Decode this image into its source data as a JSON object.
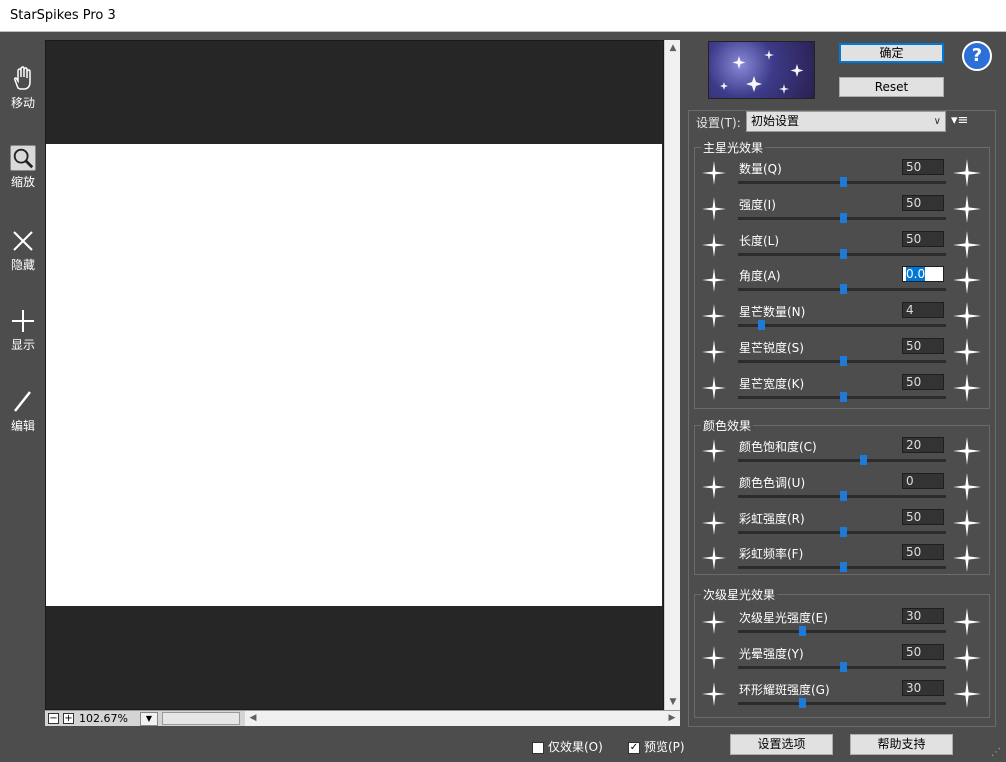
{
  "window": {
    "title": "StarSpikes Pro 3"
  },
  "tools": [
    {
      "label": "移动",
      "icon": "hand-icon"
    },
    {
      "label": "缩放",
      "icon": "zoom-icon"
    },
    {
      "label": "隐藏",
      "icon": "x-icon"
    },
    {
      "label": "显示",
      "icon": "plus-icon"
    },
    {
      "label": "编辑",
      "icon": "pencil-icon"
    }
  ],
  "active_tool": "缩放",
  "zoom": {
    "value": "102.67%"
  },
  "buttons": {
    "ok": "确定",
    "reset": "Reset",
    "help": "?",
    "options": "设置选项",
    "support": "帮助支持"
  },
  "settings": {
    "label": "设置(T):",
    "selected": "初始设置"
  },
  "groups": {
    "main": "主星光效果",
    "color": "颜色效果",
    "secondary": "次级星光效果"
  },
  "sliders": [
    {
      "label": "数量(Q)",
      "value": "50",
      "pos": 0.5
    },
    {
      "label": "强度(I)",
      "value": "50",
      "pos": 0.5
    },
    {
      "label": "长度(L)",
      "value": "50",
      "pos": 0.5
    },
    {
      "label": "角度(A)",
      "value": "0.0",
      "pos": 0.5
    },
    {
      "label": "星芒数量(N)",
      "value": "4",
      "pos": 0.1
    },
    {
      "label": "星芒锐度(S)",
      "value": "50",
      "pos": 0.5
    },
    {
      "label": "星芒宽度(K)",
      "value": "50",
      "pos": 0.5
    },
    {
      "label": "颜色饱和度(C)",
      "value": "20",
      "pos": 0.6
    },
    {
      "label": "颜色色调(U)",
      "value": "0",
      "pos": 0.5
    },
    {
      "label": "彩虹强度(R)",
      "value": "50",
      "pos": 0.5
    },
    {
      "label": "彩虹频率(F)",
      "value": "50",
      "pos": 0.5
    },
    {
      "label": "次级星光强度(E)",
      "value": "30",
      "pos": 0.3
    },
    {
      "label": "光晕强度(Y)",
      "value": "50",
      "pos": 0.5
    },
    {
      "label": "环形耀斑强度(G)",
      "value": "30",
      "pos": 0.3
    }
  ],
  "checkboxes": {
    "effect_only": {
      "label": "仅效果(O)",
      "checked": false
    },
    "preview": {
      "label": "预览(P)",
      "checked": true
    }
  },
  "colors": {
    "accent": "#1e7ad6",
    "canvas_bg": "#262626",
    "panel_bg": "#4d4d4d"
  }
}
